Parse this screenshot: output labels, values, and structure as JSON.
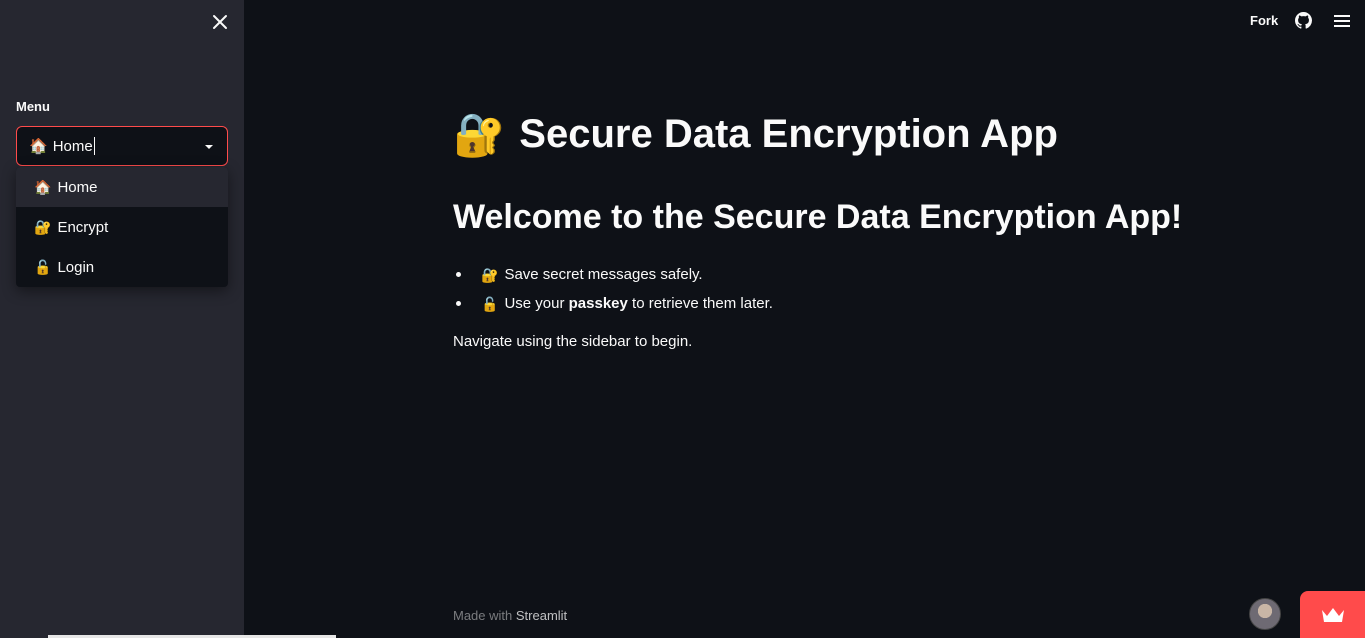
{
  "sidebar": {
    "close_icon": "close-icon",
    "menu_label": "Menu",
    "select": {
      "emoji": "🏠",
      "value": "Home"
    },
    "options": [
      {
        "emoji": "🏠",
        "label": "Home"
      },
      {
        "emoji": "🔐",
        "label": "Encrypt"
      },
      {
        "emoji": "🔓",
        "label": "Login"
      }
    ]
  },
  "header": {
    "fork_label": "Fork",
    "github_icon": "github-icon",
    "menu_icon": "hamburger-menu-icon"
  },
  "main": {
    "title_emoji": "🔐",
    "title": "Secure Data Encryption App",
    "subtitle": "Welcome to the Secure Data Encryption App!",
    "bullets": [
      {
        "emoji": "🔐",
        "text": "Save secret messages safely."
      },
      {
        "emoji": "🔓",
        "pre": "Use your ",
        "bold": "passkey",
        "post": " to retrieve them later."
      }
    ],
    "nav_text": "Navigate using the sidebar to begin."
  },
  "footer": {
    "made_with": "Made with ",
    "brand": "Streamlit"
  },
  "colors": {
    "background": "#0e1117",
    "sidebar": "#262730",
    "accent": "#ff4b4b",
    "text": "#fafafa"
  }
}
